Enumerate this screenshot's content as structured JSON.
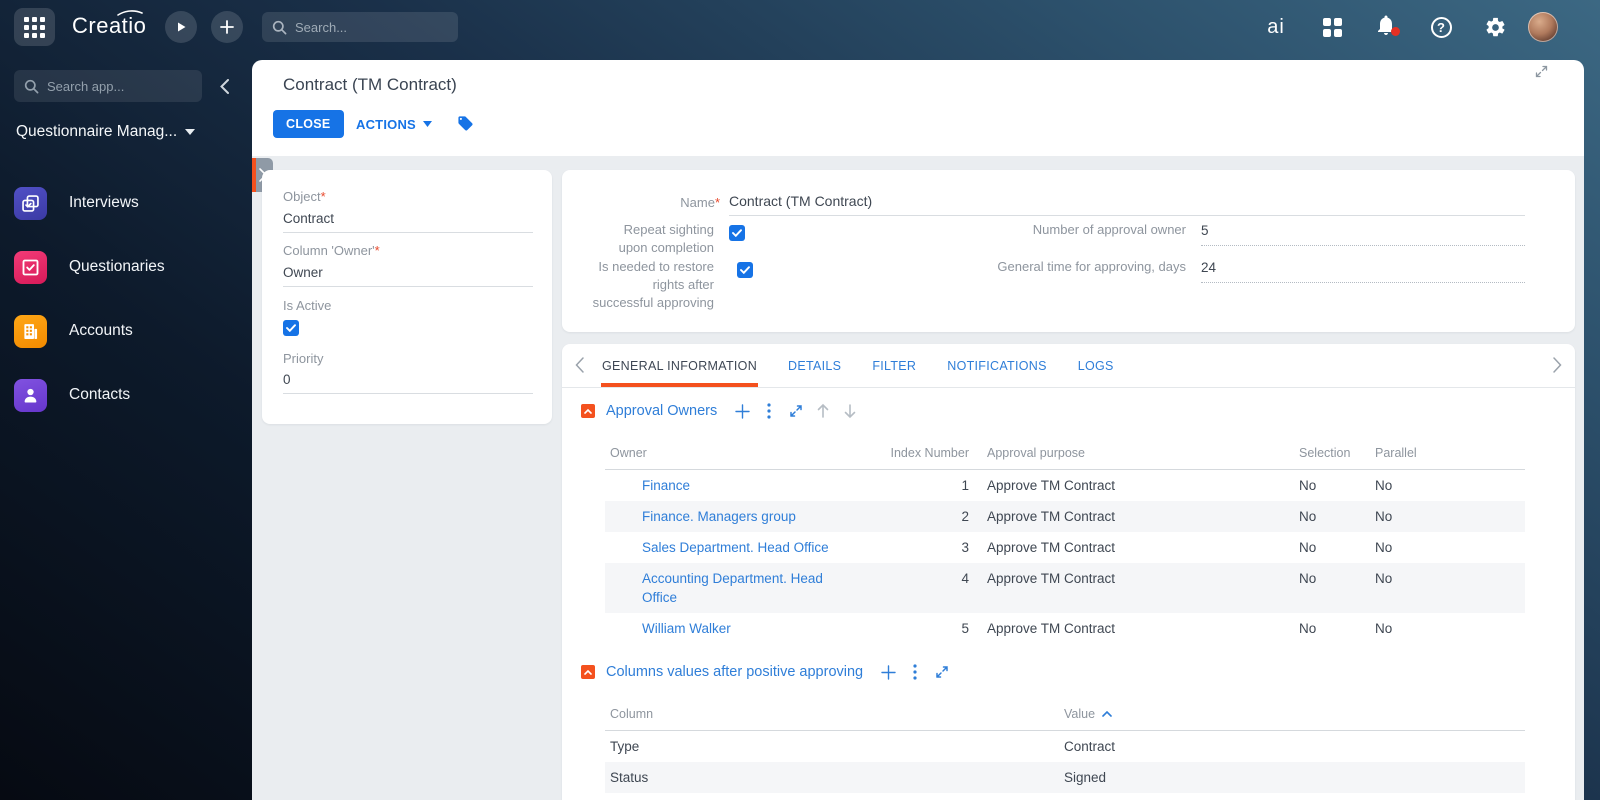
{
  "topbar": {
    "logo_text": "Creatio",
    "search_placeholder": "Search...",
    "ai_label": "ai"
  },
  "sidebar": {
    "search_placeholder": "Search app...",
    "workspace_name": "Questionnaire Manag...",
    "items": [
      {
        "label": "Interviews",
        "color": "#4544b4"
      },
      {
        "label": "Questionaries",
        "color": "#e81f63"
      },
      {
        "label": "Accounts",
        "color": "#fb9700"
      },
      {
        "label": "Contacts",
        "color": "#7343d8"
      }
    ]
  },
  "page": {
    "title": "Contract (TM Contract)",
    "close_button": "CLOSE",
    "actions_button": "ACTIONS"
  },
  "ui": {
    "required_mark": "*"
  },
  "icons": {
    "help_glyph": "?"
  },
  "left_form": {
    "object_label": "Object",
    "object_value": "Contract",
    "owner_label": "Column 'Owner'",
    "owner_value": "Owner",
    "is_active_label": "Is Active",
    "priority_label": "Priority",
    "priority_value": "0"
  },
  "main_form": {
    "name_label": "Name",
    "name_value": "Contract (TM Contract)",
    "repeat_label": "Repeat sighting upon completion",
    "restore_label": "Is needed to restore rights after successful approving",
    "number_label": "Number of approval owner",
    "number_value": "5",
    "time_label": "General time for approving, days",
    "time_value": "24"
  },
  "tabs": {
    "items": [
      "GENERAL INFORMATION",
      "DETAILS",
      "FILTER",
      "NOTIFICATIONS",
      "LOGS"
    ],
    "active": "GENERAL INFORMATION"
  },
  "sections": {
    "approval": {
      "title": "Approval Owners"
    },
    "columns": {
      "title": "Columns values after positive approving"
    }
  },
  "approval_table": {
    "headers": {
      "owner": "Owner",
      "index": "Index Number",
      "purpose": "Approval purpose",
      "selection": "Selection",
      "parallel": "Parallel"
    },
    "rows": [
      {
        "owner": "Finance",
        "index": "1",
        "purpose": "Approve TM Contract",
        "selection": "No",
        "parallel": "No"
      },
      {
        "owner": "Finance. Managers group",
        "index": "2",
        "purpose": "Approve TM Contract",
        "selection": "No",
        "parallel": "No"
      },
      {
        "owner": "Sales Department. Head Office",
        "index": "3",
        "purpose": "Approve TM Contract",
        "selection": "No",
        "parallel": "No"
      },
      {
        "owner": "Accounting Department. Head Office",
        "index": "4",
        "purpose": "Approve TM Contract",
        "selection": "No",
        "parallel": "No"
      },
      {
        "owner": "William Walker",
        "index": "5",
        "purpose": "Approve TM Contract",
        "selection": "No",
        "parallel": "No"
      }
    ]
  },
  "columns_table": {
    "headers": {
      "column": "Column",
      "value": "Value"
    },
    "rows": [
      {
        "column": "Type",
        "value": "Contract"
      },
      {
        "column": "Status",
        "value": "Signed"
      }
    ]
  },
  "colors": {
    "accent_blue": "#1673e6",
    "accent_orange": "#f4511e",
    "link_blue": "#2f7ed8"
  }
}
